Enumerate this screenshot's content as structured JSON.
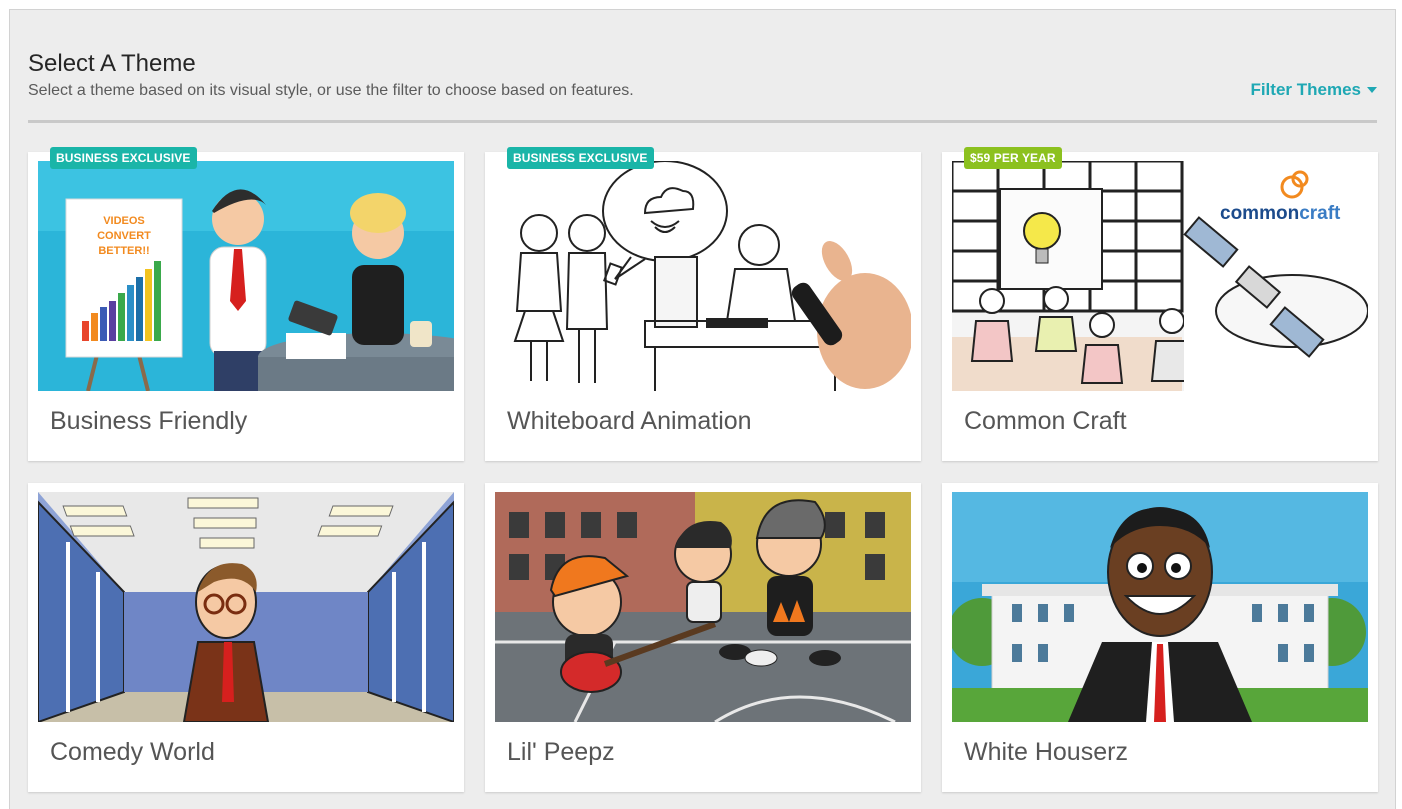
{
  "header": {
    "title": "Select A Theme",
    "subtitle": "Select a theme based on its visual style, or use the filter to choose based on features.",
    "filter_label": "Filter Themes"
  },
  "themes": [
    {
      "name": "Business Friendly",
      "badge": "BUSINESS EXCLUSIVE",
      "badge_color": "#1ab5a8",
      "poster_lines": [
        "VIDEOS",
        "CONVERT",
        "BETTER!!"
      ]
    },
    {
      "name": "Whiteboard Animation",
      "badge": "BUSINESS EXCLUSIVE",
      "badge_color": "#1ab5a8"
    },
    {
      "name": "Common Craft",
      "badge": "$59 PER YEAR",
      "badge_color": "#8cc11f",
      "logo_part1": "common",
      "logo_part2": "craft"
    },
    {
      "name": "Comedy World"
    },
    {
      "name": "Lil' Peepz"
    },
    {
      "name": "White Houserz"
    }
  ],
  "colors": {
    "accent": "#1fa8b4",
    "business_badge": "#1ab5a8",
    "price_badge": "#8cc11f"
  }
}
